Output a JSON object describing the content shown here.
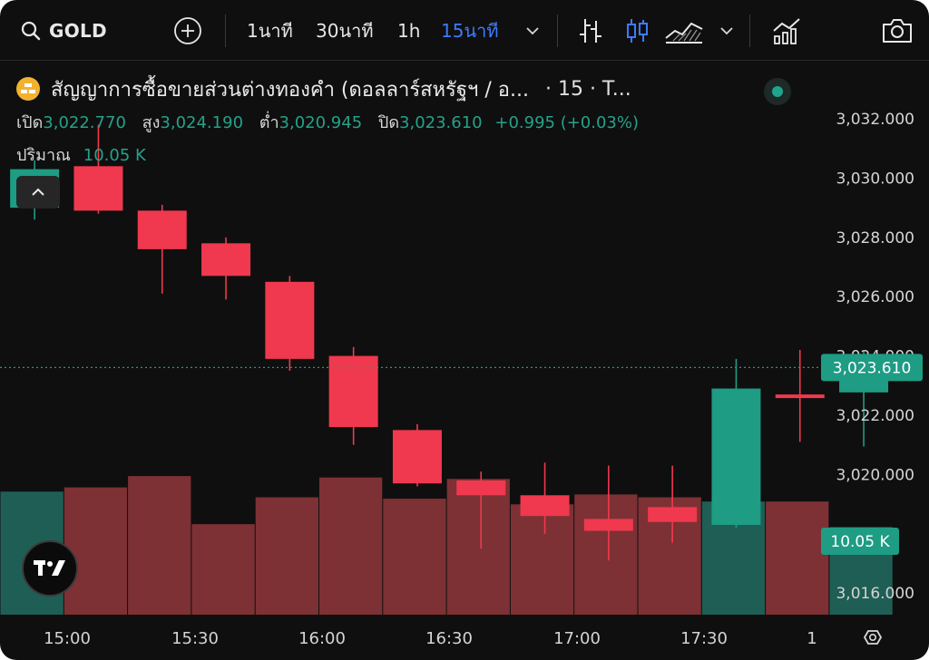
{
  "toolbar": {
    "symbol": "GOLD",
    "timeframes": [
      "1นาที",
      "30นาที",
      "1h",
      "15นาที"
    ],
    "active_timeframe": "15นาที",
    "accent_color": "#3d7bfd"
  },
  "legend": {
    "title": "สัญญาการซื้อขายส่วนต่างทองคำ (ดอลลาร์สหรัฐฯ / อ...",
    "interval": "· 15 · T...",
    "open_label": "เปิด",
    "open_value": "3,022.770",
    "high_label": "สูง",
    "high_value": "3,024.190",
    "low_label": "ต่ำ",
    "low_value": "3,020.945",
    "close_label": "ปิด",
    "close_value": "3,023.610",
    "change": "+0.995 (+0.03%)",
    "volume_label": "ปริมาณ",
    "volume_value": "10.05 K"
  },
  "colors": {
    "up": "#1e9c84",
    "down": "#f0394e",
    "vol_up": "#1f5e55",
    "vol_down": "#7d3134",
    "bg": "#0f0f0f"
  },
  "chart_data": {
    "type": "candlestick",
    "x_tick_labels": [
      "15:00",
      "15:30",
      "16:00",
      "16:30",
      "17:00",
      "17:30",
      "1"
    ],
    "y_tick_labels": [
      "3,032.000",
      "3,030.000",
      "3,028.000",
      "3,026.000",
      "3,024.000",
      "3,022.000",
      "3,020.000",
      "3,016.000"
    ],
    "ylim": [
      3015.4,
      3032.5
    ],
    "last_price_label": "3,023.610",
    "last_price": 3023.61,
    "volume_label": "10.05 K",
    "candles": [
      {
        "open": 3029.0,
        "high": 3030.6,
        "low": 3028.6,
        "close": 3030.3,
        "volume": 8.7
      },
      {
        "open": 3030.4,
        "high": 3031.8,
        "low": 3028.8,
        "close": 3028.9,
        "volume": 9.0
      },
      {
        "open": 3028.9,
        "high": 3029.1,
        "low": 3026.1,
        "close": 3027.6,
        "volume": 9.8
      },
      {
        "open": 3027.8,
        "high": 3028.0,
        "low": 3025.9,
        "close": 3026.7,
        "volume": 6.4
      },
      {
        "open": 3026.5,
        "high": 3026.7,
        "low": 3023.5,
        "close": 3023.9,
        "volume": 8.3
      },
      {
        "open": 3024.0,
        "high": 3024.3,
        "low": 3021.0,
        "close": 3021.6,
        "volume": 9.7
      },
      {
        "open": 3021.5,
        "high": 3021.7,
        "low": 3019.6,
        "close": 3019.7,
        "volume": 8.2
      },
      {
        "open": 3019.8,
        "high": 3020.1,
        "low": 3017.5,
        "close": 3019.3,
        "volume": 9.6
      },
      {
        "open": 3019.3,
        "high": 3020.4,
        "low": 3018.0,
        "close": 3018.6,
        "volume": 7.8
      },
      {
        "open": 3018.5,
        "high": 3020.3,
        "low": 3017.1,
        "close": 3018.1,
        "volume": 8.5
      },
      {
        "open": 3018.9,
        "high": 3020.3,
        "low": 3017.7,
        "close": 3018.4,
        "volume": 8.3
      },
      {
        "open": 3018.3,
        "high": 3023.9,
        "low": 3018.2,
        "close": 3022.9,
        "volume": 8.0
      },
      {
        "open": 3022.7,
        "high": 3024.2,
        "low": 3021.1,
        "close": 3022.6,
        "volume": 8.0
      },
      {
        "open": 3022.77,
        "high": 3024.19,
        "low": 3020.945,
        "close": 3023.61,
        "volume": 6.2
      }
    ]
  }
}
